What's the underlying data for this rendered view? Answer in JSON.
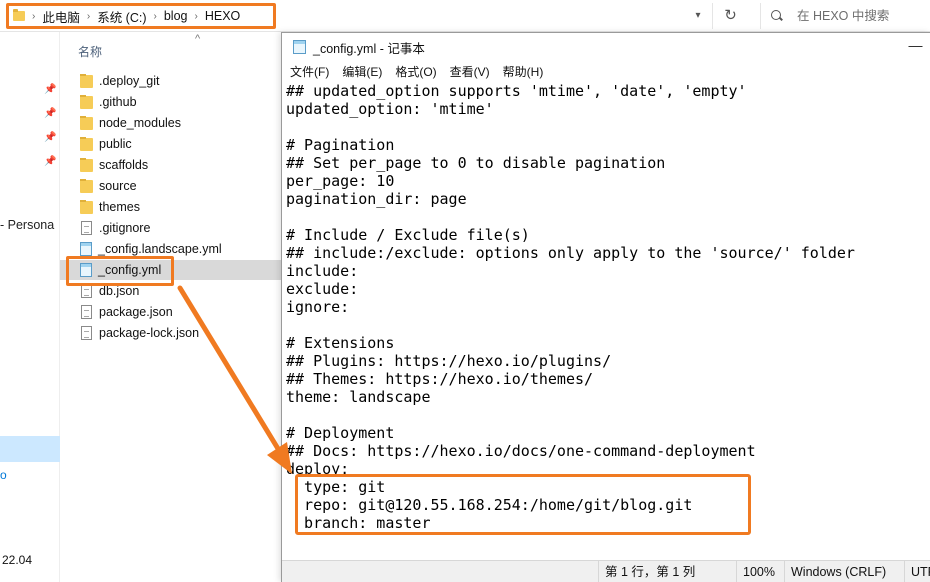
{
  "explorer": {
    "breadcrumb": [
      "此电脑",
      "系统 (C:)",
      "blog",
      "HEXO"
    ],
    "search_placeholder": "在 HEXO 中搜索",
    "column_header": "名称",
    "files": [
      {
        "name": ".deploy_git",
        "type": "folder"
      },
      {
        "name": ".github",
        "type": "folder"
      },
      {
        "name": "node_modules",
        "type": "folder"
      },
      {
        "name": "public",
        "type": "folder"
      },
      {
        "name": "scaffolds",
        "type": "folder"
      },
      {
        "name": "source",
        "type": "folder"
      },
      {
        "name": "themes",
        "type": "folder"
      },
      {
        "name": ".gitignore",
        "type": "file"
      },
      {
        "name": "_config.landscape.yml",
        "type": "notepad"
      },
      {
        "name": "_config.yml",
        "type": "notepad",
        "selected": true
      },
      {
        "name": "db.json",
        "type": "file"
      },
      {
        "name": "package.json",
        "type": "file"
      },
      {
        "name": "package-lock.json",
        "type": "file"
      }
    ],
    "nav": {
      "personal_label": "- Persona",
      "blue_mark": "o",
      "bottom_label": "22.04"
    }
  },
  "notepad": {
    "title": "_config.yml - 记事本",
    "minimize_symbol": "—",
    "menu": [
      "文件(F)",
      "编辑(E)",
      "格式(O)",
      "查看(V)",
      "帮助(H)"
    ],
    "lines": [
      "## updated_option supports 'mtime', 'date', 'empty'",
      "updated_option: 'mtime'",
      "",
      "# Pagination",
      "## Set per_page to 0 to disable pagination",
      "per_page: 10",
      "pagination_dir: page",
      "",
      "# Include / Exclude file(s)",
      "## include:/exclude: options only apply to the 'source/' folder",
      "include:",
      "exclude:",
      "ignore:",
      "",
      "# Extensions",
      "## Plugins: https://hexo.io/plugins/",
      "## Themes: https://hexo.io/themes/",
      "theme: landscape",
      "",
      "# Deployment",
      "## Docs: https://hexo.io/docs/one-command-deployment",
      "deploy:",
      "  type: git",
      "  repo: git@120.55.168.254:/home/git/blog.git",
      "  branch: master"
    ],
    "status": {
      "position": "第 1 行，第 1 列",
      "zoom": "100%",
      "line_ending": "Windows (CRLF)",
      "encoding": "UTF"
    }
  },
  "colors": {
    "highlight": "#f07a21",
    "selection": "#d9d9d9",
    "folder": "#f6cc57"
  }
}
